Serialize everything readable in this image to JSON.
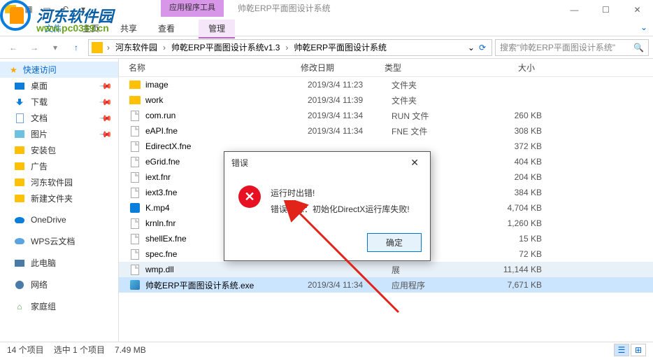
{
  "window": {
    "contextual_tab": "应用程序工具",
    "title": "帅乾ERP平面图设计系统",
    "ribbon_tabs": [
      "文件",
      "主页",
      "共享",
      "查看"
    ],
    "ribbon_context_tab": "管理"
  },
  "logo": {
    "text": "河东软件园",
    "url": "www.pc0359.cn"
  },
  "breadcrumb": {
    "items": [
      "河东软件园",
      "帅乾ERP平面图设计系统v1.3",
      "帅乾ERP平面图设计系统"
    ]
  },
  "search": {
    "placeholder": "搜索\"帅乾ERP平面图设计系统\""
  },
  "sidebar": {
    "quick": "快速访问",
    "items": [
      "桌面",
      "下载",
      "文档",
      "图片",
      "安装包",
      "广告",
      "河东软件园",
      "新建文件夹"
    ],
    "onedrive": "OneDrive",
    "wps": "WPS云文档",
    "pc": "此电脑",
    "network": "网络",
    "homegroup": "家庭组"
  },
  "columns": {
    "name": "名称",
    "date": "修改日期",
    "type": "类型",
    "size": "大小"
  },
  "files": [
    {
      "n": "image",
      "d": "2019/3/4 11:23",
      "t": "文件夹",
      "s": "",
      "icon": "folder"
    },
    {
      "n": "work",
      "d": "2019/3/4 11:39",
      "t": "文件夹",
      "s": "",
      "icon": "folder"
    },
    {
      "n": "com.run",
      "d": "2019/3/4 11:34",
      "t": "RUN 文件",
      "s": "260 KB",
      "icon": "file"
    },
    {
      "n": "eAPI.fne",
      "d": "2019/3/4 11:34",
      "t": "FNE 文件",
      "s": "308 KB",
      "icon": "file"
    },
    {
      "n": "EdirectX.fne",
      "d": "",
      "t": "",
      "s": "372 KB",
      "icon": "file"
    },
    {
      "n": "eGrid.fne",
      "d": "",
      "t": "",
      "s": "404 KB",
      "icon": "file"
    },
    {
      "n": "iext.fnr",
      "d": "",
      "t": "",
      "s": "204 KB",
      "icon": "file"
    },
    {
      "n": "iext3.fne",
      "d": "",
      "t": "",
      "s": "384 KB",
      "icon": "file"
    },
    {
      "n": "K.mp4",
      "d": "",
      "t": "",
      "s": "4,704 KB",
      "icon": "video"
    },
    {
      "n": "krnln.fnr",
      "d": "",
      "t": "",
      "s": "1,260 KB",
      "icon": "file"
    },
    {
      "n": "shellEx.fne",
      "d": "",
      "t": "",
      "s": "15 KB",
      "icon": "file"
    },
    {
      "n": "spec.fne",
      "d": "",
      "t": "",
      "s": "72 KB",
      "icon": "file"
    },
    {
      "n": "wmp.dll",
      "d": "",
      "t": "展",
      "s": "11,144 KB",
      "icon": "file",
      "hover": true
    },
    {
      "n": "帅乾ERP平面图设计系统.exe",
      "d": "2019/3/4 11:34",
      "t": "应用程序",
      "s": "7,671 KB",
      "icon": "exe",
      "selected": true
    }
  ],
  "status": {
    "count": "14 个项目",
    "selection": "选中 1 个项目",
    "size": "7.49 MB"
  },
  "dialog": {
    "title": "错误",
    "line1": "运行时出错!",
    "line2": "错误信息：初始化DirectX运行库失败!",
    "ok": "确定"
  }
}
